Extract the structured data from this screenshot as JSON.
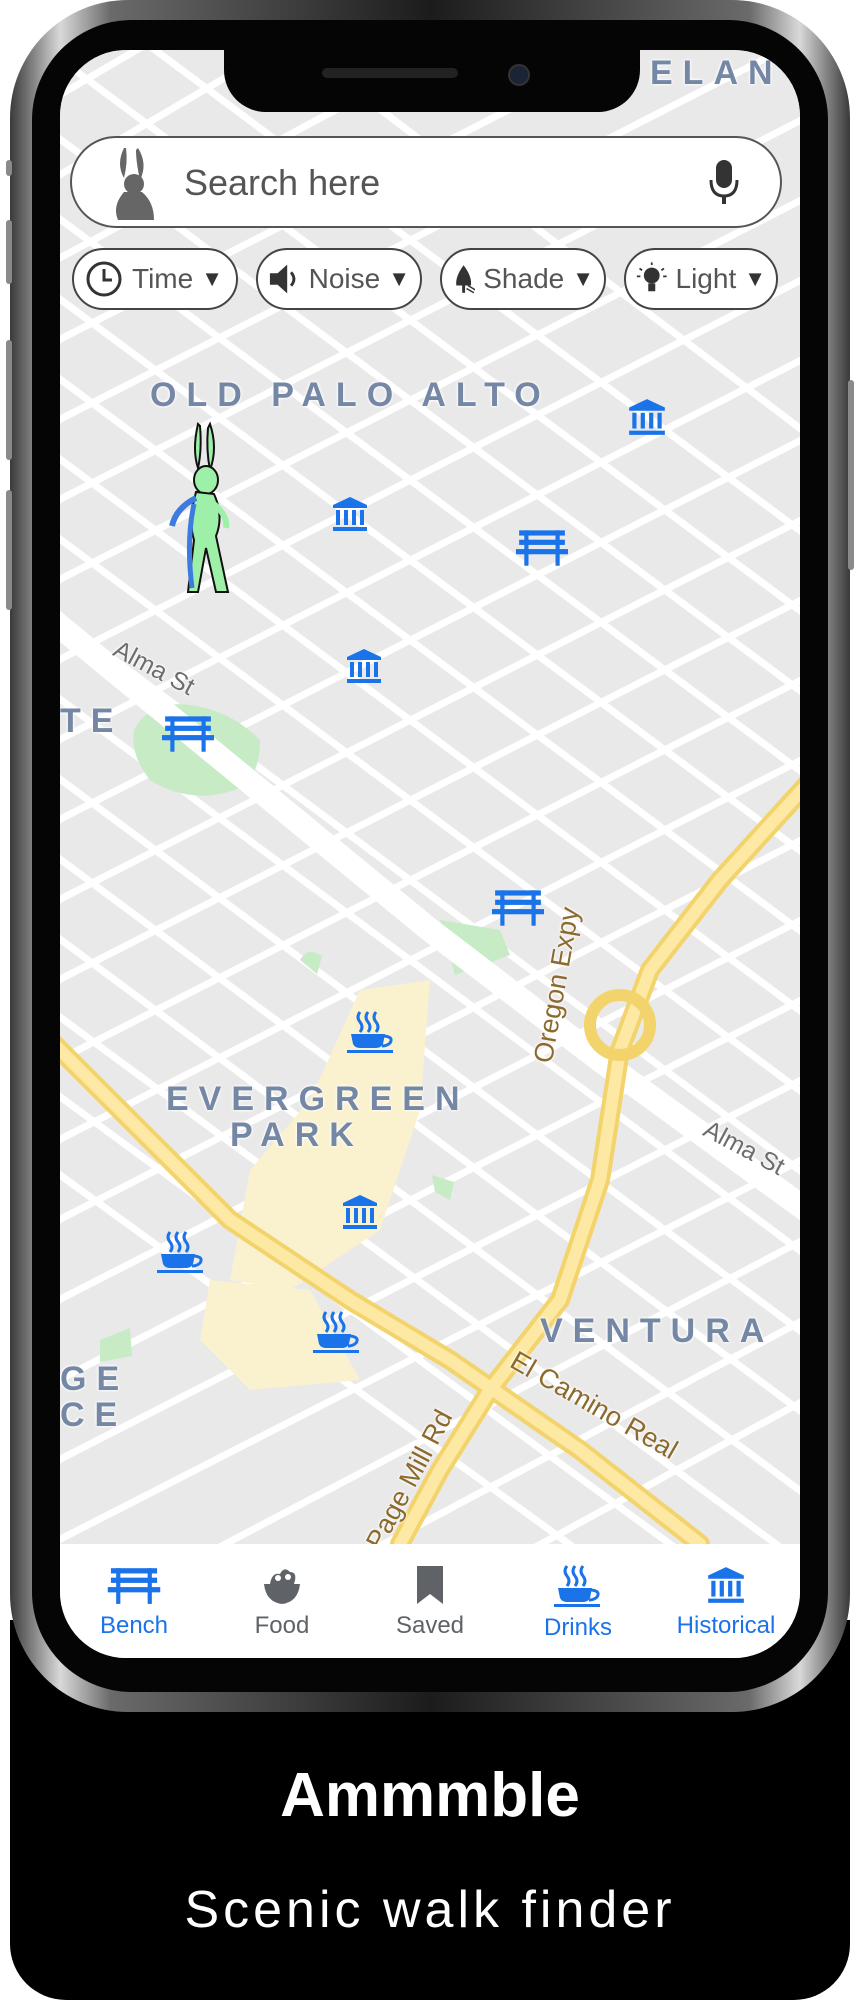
{
  "search": {
    "placeholder": "Search here"
  },
  "filters": [
    {
      "label": "Time",
      "icon": "clock-icon"
    },
    {
      "label": "Noise",
      "icon": "speaker-icon"
    },
    {
      "label": "Shade",
      "icon": "tree-icon"
    },
    {
      "label": "Light",
      "icon": "lightbulb-icon"
    }
  ],
  "map": {
    "areas": [
      "OLD PALO ALTO",
      "EVERGREEN",
      "PARK",
      "VENTURA"
    ],
    "edge_fragments": [
      "ELAN",
      "TE",
      "GE",
      "CE"
    ],
    "roads": [
      "Alma St",
      "Alma St",
      "Oregon Expy",
      "El Camino Real",
      "Page Mill Rd"
    ]
  },
  "nav": [
    {
      "label": "Bench",
      "icon": "bench-icon",
      "active": true
    },
    {
      "label": "Food",
      "icon": "food-icon",
      "active": false
    },
    {
      "label": "Saved",
      "icon": "bookmark-icon",
      "active": false
    },
    {
      "label": "Drinks",
      "icon": "coffee-icon",
      "active": true
    },
    {
      "label": "Historical",
      "icon": "museum-icon",
      "active": true
    }
  ],
  "colors": {
    "accent": "#1a73e8",
    "inactive": "#5f6368",
    "map_background": "#e9e9ea",
    "major_road": "#fce38a",
    "park": "#c6ebc5"
  },
  "footer": {
    "app_name": "Ammmble",
    "tagline": "Scenic walk finder"
  }
}
